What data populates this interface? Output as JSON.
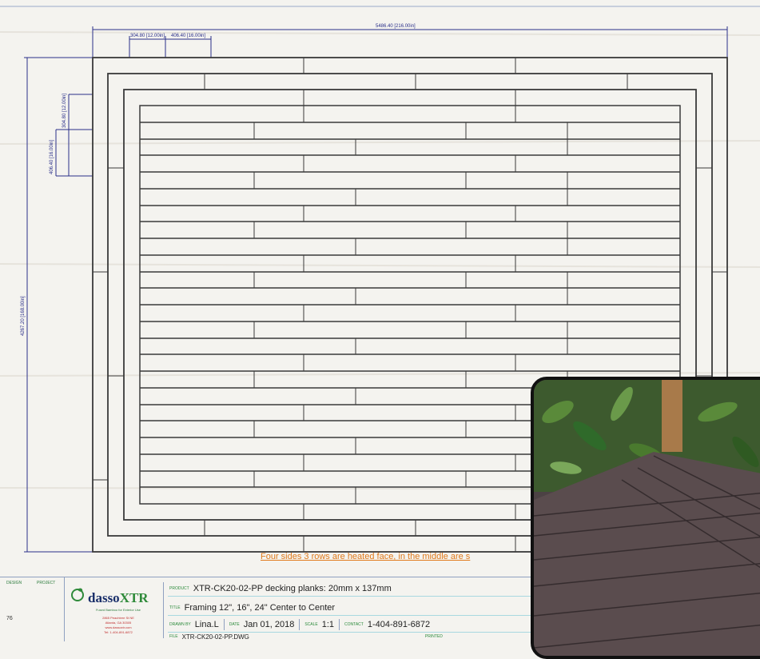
{
  "dimensions": {
    "overall_width": "5486.40 [216.00in]",
    "overall_height": "4267.20 [168.00in]",
    "spacing_12": "304.80 [12.00in]",
    "spacing_16": "406.40 [16.00in]",
    "v_spacing_12": "304.80 [12.00in]",
    "v_spacing_16": "406.40 [16.00in]"
  },
  "note": "Four sides 3 rows are heated face, in the middle are s",
  "titleblock": {
    "left_label_1": "DESIGN",
    "left_label_2": "PROJECT",
    "left_mark": "76",
    "logo_brand": "dasso",
    "logo_accent": "XTR",
    "logo_tagline": "Fused Bamboo for Exterior Use",
    "logo_contact_lines": [
      "2865 Peachtree St NE",
      "Atlanta, GA 30305",
      "www.dassoxtr.com",
      "Tel: 1-404-891-6872"
    ],
    "product_label": "PRODUCT",
    "product_value": "XTR-CK20-02-PP decking planks:  20mm x 137mm",
    "title_label": "TITLE",
    "title_value": "Framing 12\", 16\", 24\" Center to Center",
    "drawn_label": "DRAWN BY",
    "drawn_value": "Lina.L",
    "date_label": "DATE",
    "date_value": "Jan 01, 2018",
    "scale_label": "SCALE",
    "scale_value": "1:1",
    "contact_label": "CONTACT",
    "contact_value": "1-404-891-6872",
    "file_label": "FILE",
    "file_value": "XTR-CK20-02-PP.DWG",
    "printed_label": "PRINTED"
  },
  "colors": {
    "dimension": "#2a2f8a",
    "plank_line": "#3a3a3a",
    "note": "#e07a1c",
    "label_green": "#2a8a3a",
    "deck_wood": "#5a4c4e",
    "post": "#a87a4a",
    "foliage": "#2f6a2a"
  },
  "icons": {
    "logo": "dasso-leaf-logo-icon"
  }
}
